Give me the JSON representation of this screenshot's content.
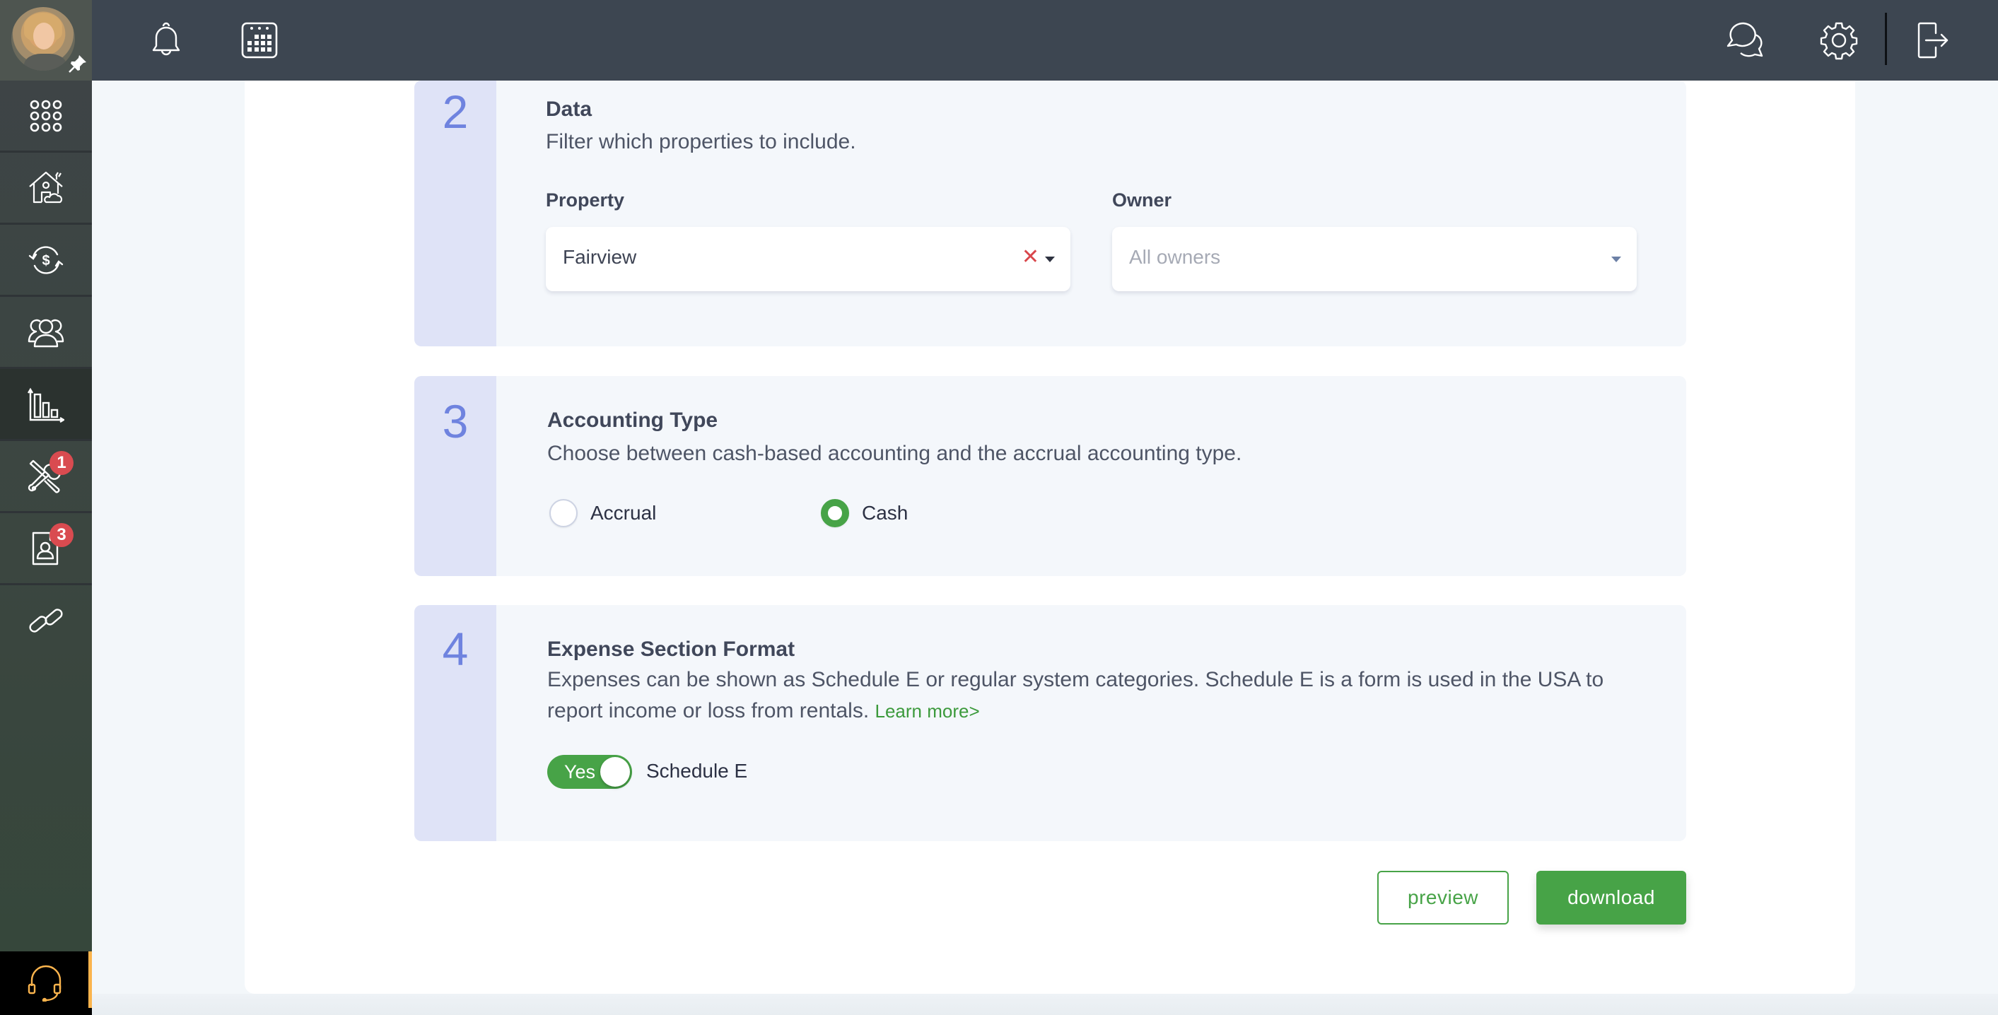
{
  "header": {
    "icons": [
      "notifications-icon",
      "calendar-icon",
      "chat-icon",
      "settings-icon",
      "logout-icon"
    ]
  },
  "sidebar": {
    "user": {
      "avatar": "user-avatar",
      "pin": "pin-icon"
    },
    "items": [
      {
        "icon": "apps-grid-icon",
        "active": false,
        "badge": null
      },
      {
        "icon": "properties-icon",
        "active": false,
        "badge": null
      },
      {
        "icon": "transactions-icon",
        "active": false,
        "badge": null
      },
      {
        "icon": "people-icon",
        "active": false,
        "badge": null
      },
      {
        "icon": "reports-icon",
        "active": true,
        "badge": null
      },
      {
        "icon": "maintenance-icon",
        "active": false,
        "badge": "1"
      },
      {
        "icon": "applicants-icon",
        "active": false,
        "badge": "3"
      },
      {
        "icon": "integrations-icon",
        "active": false,
        "badge": null
      }
    ],
    "support_icon": "headset-icon"
  },
  "sections": {
    "data": {
      "number": "2",
      "title": "Data",
      "description": "Filter which properties to include.",
      "property": {
        "label": "Property",
        "value": "Fairview",
        "clear": "✕"
      },
      "owner": {
        "label": "Owner",
        "placeholder": "All owners"
      }
    },
    "accounting": {
      "number": "3",
      "title": "Accounting Type",
      "description": "Choose between cash-based accounting and the accrual accounting type.",
      "options": [
        {
          "label": "Accrual",
          "selected": false
        },
        {
          "label": "Cash",
          "selected": true
        }
      ]
    },
    "expense": {
      "number": "4",
      "title": "Expense Section Format",
      "description_line1": "Expenses can be shown as Schedule E or regular system categories. Schedule E is a form is used in the USA to",
      "description_line2": "report income or loss from rentals.",
      "learn_more": "Learn more>",
      "toggle": {
        "state_label": "Yes",
        "on": true,
        "label": "Schedule E"
      }
    }
  },
  "actions": {
    "preview": "preview",
    "download": "download"
  },
  "colors": {
    "accent_green": "#47a347",
    "step_number": "#6f83df",
    "badge_red": "#d94b50",
    "support_orange": "#fbb44d",
    "header_bg": "#3d4651"
  }
}
